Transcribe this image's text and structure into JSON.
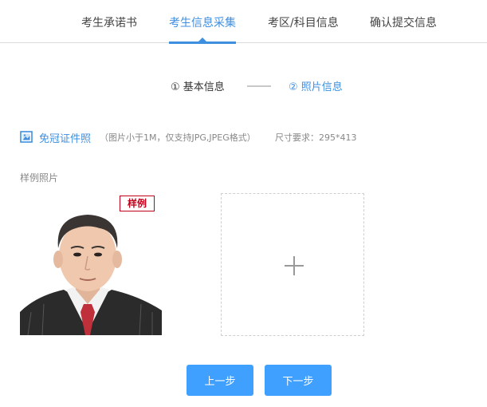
{
  "tabs": [
    {
      "label": "考生承诺书"
    },
    {
      "label": "考生信息采集"
    },
    {
      "label": "考区/科目信息"
    },
    {
      "label": "确认提交信息"
    }
  ],
  "steps": {
    "step1": "① 基本信息",
    "step2": "② 照片信息"
  },
  "upload": {
    "title": "免冠证件照",
    "hint": "（图片小于1M，仅支持JPG,JPEG格式）",
    "size_requirement": "尺寸要求：295*413",
    "sample_label": "样例照片",
    "sample_tag": "样例"
  },
  "buttons": {
    "prev": "上一步",
    "next": "下一步"
  },
  "colors": {
    "accent": "#3f8fe0",
    "button": "#40a0ff",
    "tag_red": "#c0001a"
  }
}
